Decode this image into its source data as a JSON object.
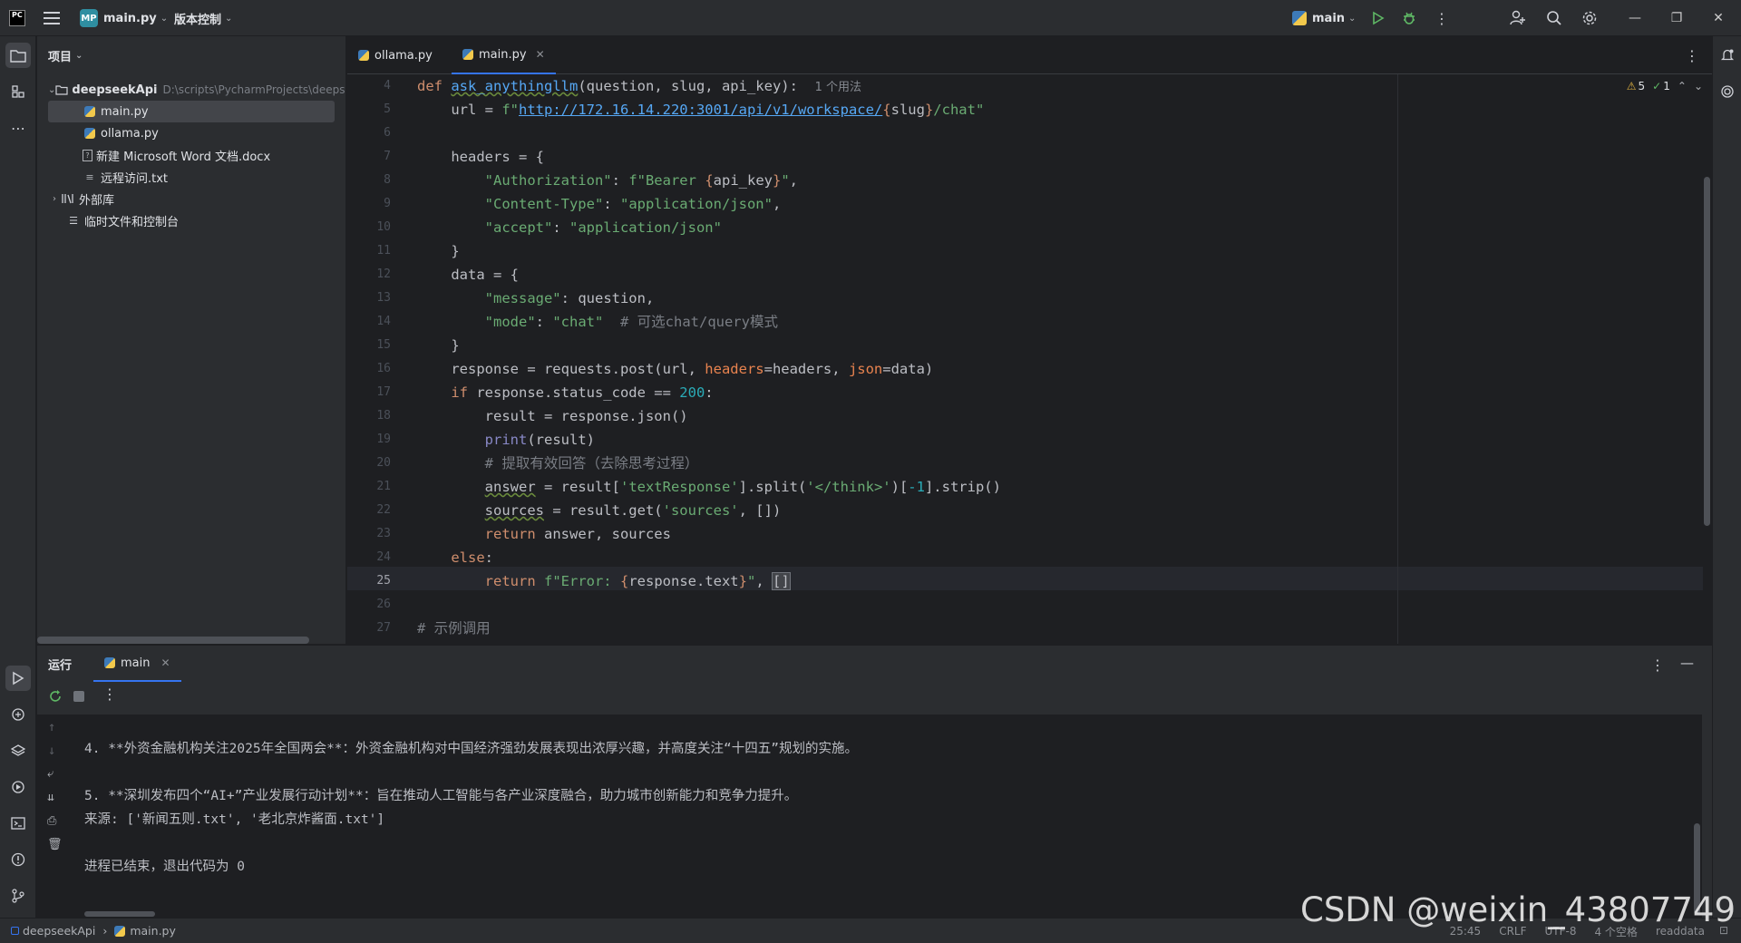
{
  "titlebar": {
    "app_logo": "PC",
    "project_badge": "MP",
    "file_name": "main.py",
    "vcs_label": "版本控制",
    "run_config": "main"
  },
  "project_panel": {
    "title": "项目",
    "root_name": "deepseekApi",
    "root_path": "D:\\scripts\\PycharmProjects\\deepse",
    "files": [
      "main.py",
      "ollama.py",
      "新建 Microsoft Word 文档.docx",
      "远程访问.txt"
    ],
    "external_libs": "外部库",
    "scratches": "临时文件和控制台"
  },
  "editor": {
    "tabs": [
      "ollama.py",
      "main.py"
    ],
    "inspections": {
      "warnings": "5",
      "ok": "1"
    },
    "line_numbers": [
      "4",
      "5",
      "6",
      "7",
      "8",
      "9",
      "10",
      "11",
      "12",
      "13",
      "14",
      "15",
      "16",
      "17",
      "18",
      "19",
      "20",
      "21",
      "22",
      "23",
      "24",
      "25",
      "26",
      "27"
    ],
    "current_line": "25",
    "code": {
      "l4_def": "def",
      "l4_fn": "ask_anythingllm",
      "l4_params": "(question, slug, api_key):",
      "l4_hint": "1 个用法",
      "l5_a": "    url = ",
      "l5_f": "f\"",
      "l5_url": "http://172.16.14.220:3001/api/v1/workspace/",
      "l5_b": "{",
      "l5_c": "slug",
      "l5_d": "}",
      "l5_e": "/chat\"",
      "l7": "    headers = {",
      "l8_key": "\"Authorization\"",
      "l8_colon": ": ",
      "l8_val1": "f\"Bearer ",
      "l8_b1": "{",
      "l8_var": "api_key",
      "l8_b2": "}",
      "l8_val2": "\"",
      "l8_end": ",",
      "l9_key": "\"Content-Type\"",
      "l9_colon": ": ",
      "l9_val": "\"application/json\"",
      "l9_end": ",",
      "l10_key": "\"accept\"",
      "l10_colon": ": ",
      "l10_val": "\"application/json\"",
      "l11": "    }",
      "l12": "    data = {",
      "l13_key": "\"message\"",
      "l13_rest": ": question,",
      "l14_key": "\"mode\"",
      "l14_colon": ": ",
      "l14_val": "\"chat\"",
      "l14_cmt": "  # 可选chat/query模式",
      "l15": "    }",
      "l16_a": "    response = requests.post(url, ",
      "l16_p1": "headers",
      "l16_b": "=headers, ",
      "l16_p2": "json",
      "l16_c": "=data)",
      "l17_kw": "if",
      "l17_a": " response.status_code == ",
      "l17_num": "200",
      "l17_b": ":",
      "l18": "        result = response.json()",
      "l19_bi": "print",
      "l19_rest": "(result)",
      "l20": "# 提取有效回答（去除思考过程）",
      "l21_var": "answer",
      "l21_a": " = result[",
      "l21_s1": "'textResponse'",
      "l21_b": "].split(",
      "l21_s2": "'</think>'",
      "l21_c": ")[",
      "l21_n": "-1",
      "l21_d": "].strip()",
      "l22_var": "sources",
      "l22_a": " = result.get(",
      "l22_s": "'sources'",
      "l22_b": ", [])",
      "l23_kw": "return",
      "l23_rest": " answer, sources",
      "l24_kw": "else",
      "l24_rest": ":",
      "l25_kw": "return",
      "l25_f": " f\"Error: ",
      "l25_b1": "{",
      "l25_var": "response.text",
      "l25_b2": "}",
      "l25_q": "\"",
      "l25_comma": ", ",
      "l25_br": "[]",
      "l27": "# 示例调用"
    }
  },
  "run_panel": {
    "title": "运行",
    "tab": "main",
    "output": [
      "4. **外资金融机构关注2025年全国两会**：外资金融机构对中国经济强劲发展表现出浓厚兴趣，并高度关注“十四五”规划的实施。",
      "5. **深圳发布四个“AI+”产业发展行动计划**：旨在推动人工智能与各产业深度融合，助力城市创新能力和竞争力提升。",
      "来源: ['新闻五则.txt', '老北京炸酱面.txt']",
      "进程已结束，退出代码为 0"
    ]
  },
  "statusbar": {
    "project": "deepseekApi",
    "file": "main.py",
    "position": "25:45",
    "line_sep": "CRLF",
    "encoding": "UTF-8",
    "indent": "4 个空格",
    "mode": "readdata"
  },
  "watermark": "CSDN @weixin_43807749"
}
